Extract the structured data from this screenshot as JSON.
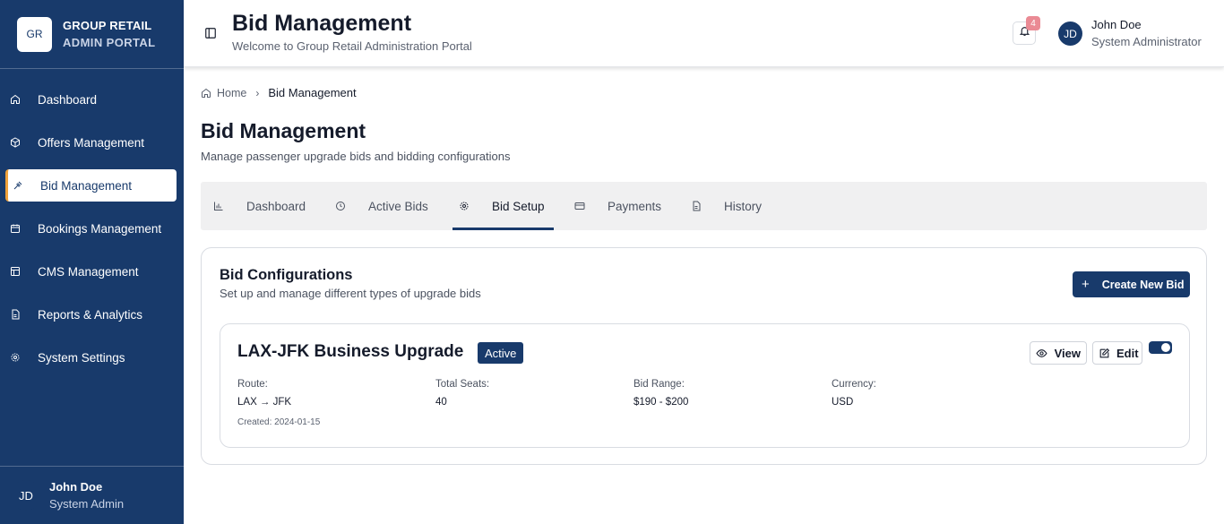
{
  "brand": {
    "logo": "GR",
    "line1": "GROUP RETAIL",
    "line2": "ADMIN PORTAL"
  },
  "nav": {
    "items": [
      {
        "label": "Dashboard",
        "icon": "home-icon"
      },
      {
        "label": "Offers Management",
        "icon": "package-icon"
      },
      {
        "label": "Bid Management",
        "icon": "gavel-icon",
        "active": true
      },
      {
        "label": "Bookings Management",
        "icon": "calendar-icon"
      },
      {
        "label": "CMS Management",
        "icon": "layout-icon"
      },
      {
        "label": "Reports & Analytics",
        "icon": "file-report-icon"
      },
      {
        "label": "System Settings",
        "icon": "gear-icon"
      }
    ]
  },
  "sidebar_user": {
    "initials": "JD",
    "name": "John Doe",
    "role": "System Admin"
  },
  "header": {
    "title": "Bid Management",
    "subtitle": "Welcome to Group Retail Administration Portal",
    "notifications": "4",
    "user_initials": "JD",
    "user_name": "John Doe",
    "user_role": "System Administrator"
  },
  "breadcrumb": {
    "home": "Home",
    "current": "Bid Management"
  },
  "page": {
    "title": "Bid Management",
    "subtitle": "Manage passenger upgrade bids and bidding configurations"
  },
  "tabs": [
    {
      "label": "Dashboard",
      "icon": "bar-chart-icon"
    },
    {
      "label": "Active Bids",
      "icon": "clock-icon"
    },
    {
      "label": "Bid Setup",
      "icon": "gear-icon",
      "active": true
    },
    {
      "label": "Payments",
      "icon": "credit-card-icon"
    },
    {
      "label": "History",
      "icon": "document-icon"
    }
  ],
  "config": {
    "title": "Bid Configurations",
    "subtitle": "Set up and manage different types of upgrade bids",
    "create_label": "Create New Bid"
  },
  "bid": {
    "name": "LAX-JFK Business Upgrade",
    "status": "Active",
    "view_label": "View",
    "edit_label": "Edit",
    "enabled": true,
    "fields": [
      {
        "label": "Route:",
        "value": "LAX → JFK"
      },
      {
        "label": "Total Seats:",
        "value": "40"
      },
      {
        "label": "Bid Range:",
        "value": "$190 - $200"
      },
      {
        "label": "Currency:",
        "value": "USD"
      }
    ],
    "created": "Created: 2024-01-15"
  },
  "colors": {
    "primary": "#183a6b",
    "accent": "#f0a23b",
    "badge": "#ea8a94"
  }
}
